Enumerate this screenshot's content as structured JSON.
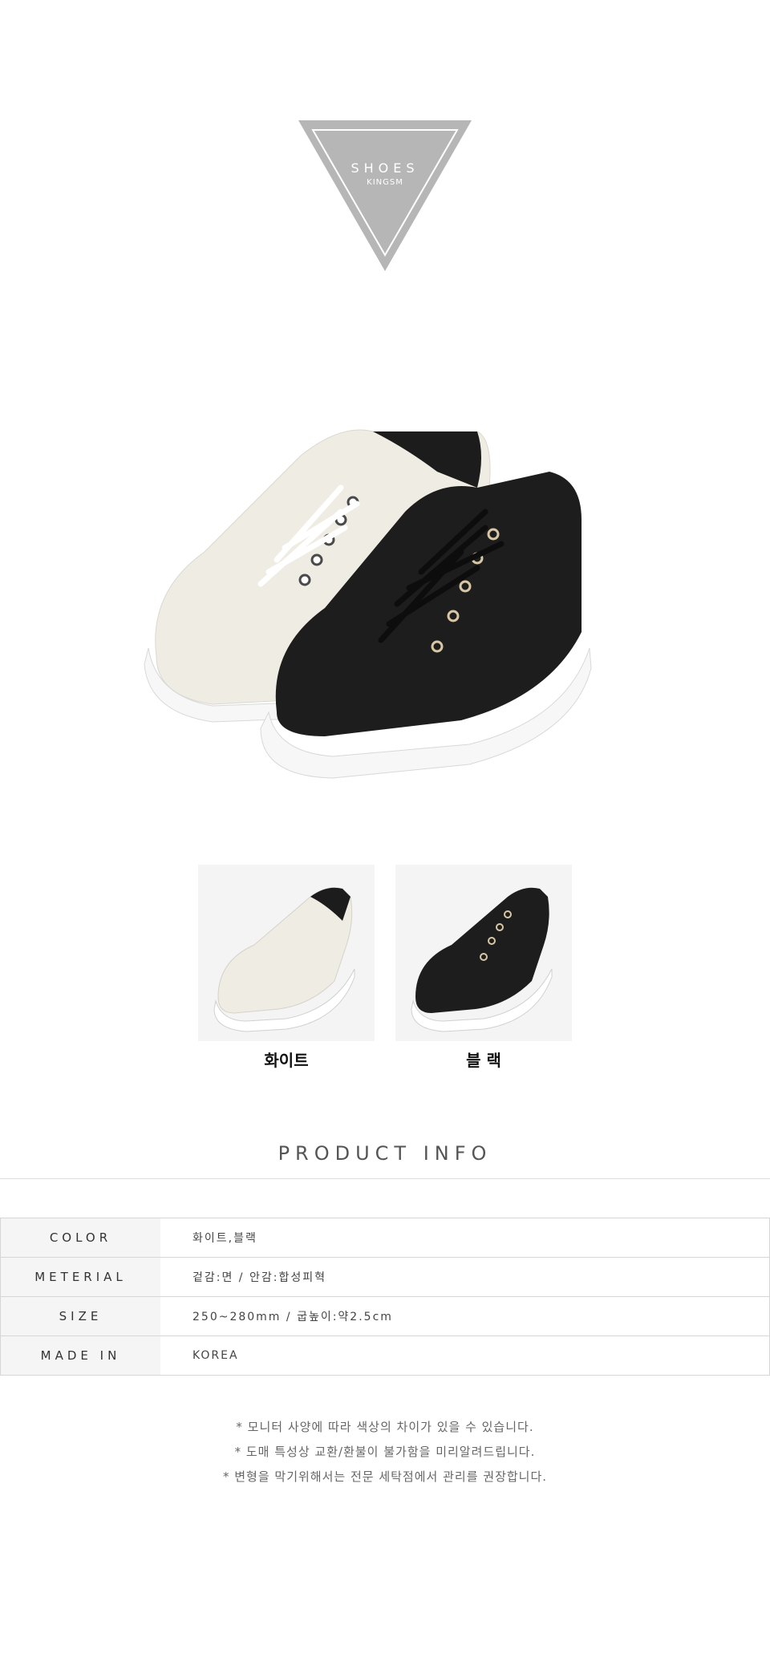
{
  "brand": {
    "title": "SHOES",
    "subtitle": "KINGSM",
    "triangle_color": "#b6b6b6"
  },
  "main_photo": {
    "alt": "white and black lace-up sneakers"
  },
  "variants": [
    {
      "label": "화이트",
      "upper_color": "#f2efe6"
    },
    {
      "label": "블 랙",
      "upper_color": "#1b1b1b"
    }
  ],
  "product_info": {
    "title": "PRODUCT INFO",
    "rows": [
      {
        "label": "COLOR",
        "value": "화이트,블랙"
      },
      {
        "label": "METERIAL",
        "value": "겉감:면 / 안감:합성피혁"
      },
      {
        "label": "SIZE",
        "value": "250~280mm / 굽높이:약2.5cm"
      },
      {
        "label": "MADE IN",
        "value": "KOREA"
      }
    ]
  },
  "notes": [
    "* 모니터 사양에 따라 색상의 차이가 있을 수 있습니다.",
    "* 도매 특성상 교환/환불이 불가함을 미리알려드립니다.",
    "* 변형을 막기위해서는 전문 세탁점에서 관리를 권장합니다."
  ]
}
